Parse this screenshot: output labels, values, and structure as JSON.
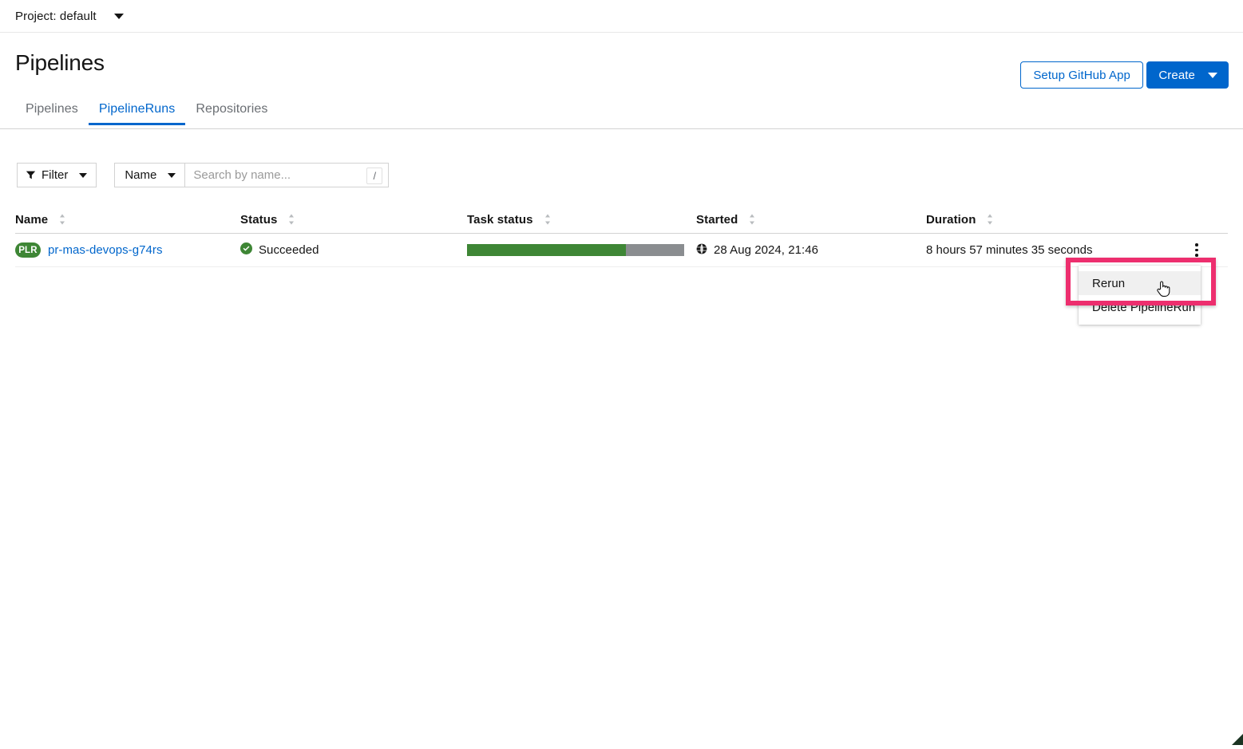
{
  "project_bar": {
    "label": "Project: default"
  },
  "header": {
    "title": "Pipelines",
    "setup_github_label": "Setup GitHub App",
    "create_label": "Create"
  },
  "tabs": [
    {
      "label": "Pipelines",
      "active": false
    },
    {
      "label": "PipelineRuns",
      "active": true
    },
    {
      "label": "Repositories",
      "active": false
    }
  ],
  "toolbar": {
    "filter_label": "Filter",
    "search_attribute": "Name",
    "search_placeholder": "Search by name...",
    "search_value": "",
    "search_shortcut": "/"
  },
  "table": {
    "columns": [
      {
        "label": "Name"
      },
      {
        "label": "Status"
      },
      {
        "label": "Task status"
      },
      {
        "label": "Started"
      },
      {
        "label": "Duration"
      }
    ],
    "rows": [
      {
        "kind_badge": "PLR",
        "name": "pr-mas-devops-g74rs",
        "status": "Succeeded",
        "task_status": {
          "succeeded_pct": 73,
          "remaining_pct": 27,
          "succeeded_color": "#3e8635",
          "remaining_color": "#8a8d90"
        },
        "started": "28 Aug 2024, 21:46",
        "duration": "8 hours 57 minutes 35 seconds"
      }
    ]
  },
  "row_menu": {
    "items": [
      {
        "label": "Rerun",
        "hovered": true
      },
      {
        "label": "Delete PipelineRun",
        "hovered": false
      }
    ]
  },
  "annotation": {
    "highlight_color": "#ed2e6e"
  },
  "colors": {
    "link": "#0066cc",
    "primary_button": "#0066cc",
    "success": "#3e8635",
    "text": "#151515",
    "muted_text": "#6a6e73"
  }
}
